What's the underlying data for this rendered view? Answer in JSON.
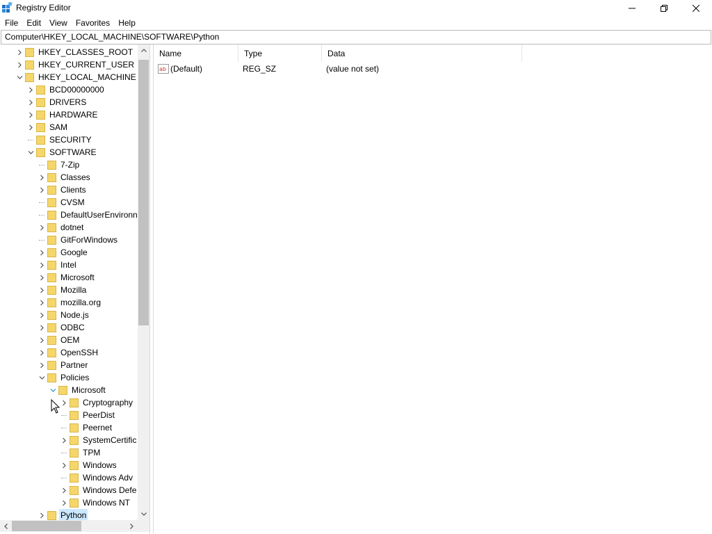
{
  "window": {
    "title": "Registry Editor",
    "minimize_glyph": "—",
    "maximize_glyph": "❐",
    "close_glyph": "✕"
  },
  "menu": [
    "File",
    "Edit",
    "View",
    "Favorites",
    "Help"
  ],
  "address": "Computer\\HKEY_LOCAL_MACHINE\\SOFTWARE\\Python",
  "tree": [
    {
      "label": "HKEY_CLASSES_ROOT",
      "level": 0,
      "expander": "collapsed"
    },
    {
      "label": "HKEY_CURRENT_USER",
      "level": 0,
      "expander": "collapsed"
    },
    {
      "label": "HKEY_LOCAL_MACHINE",
      "level": 0,
      "expander": "expanded"
    },
    {
      "label": "BCD00000000",
      "level": 1,
      "expander": "collapsed"
    },
    {
      "label": "DRIVERS",
      "level": 1,
      "expander": "collapsed"
    },
    {
      "label": "HARDWARE",
      "level": 1,
      "expander": "collapsed"
    },
    {
      "label": "SAM",
      "level": 1,
      "expander": "collapsed"
    },
    {
      "label": "SECURITY",
      "level": 1,
      "expander": "none"
    },
    {
      "label": "SOFTWARE",
      "level": 1,
      "expander": "expanded"
    },
    {
      "label": "7-Zip",
      "level": 2,
      "expander": "none"
    },
    {
      "label": "Classes",
      "level": 2,
      "expander": "collapsed"
    },
    {
      "label": "Clients",
      "level": 2,
      "expander": "collapsed"
    },
    {
      "label": "CVSM",
      "level": 2,
      "expander": "none"
    },
    {
      "label": "DefaultUserEnvironn",
      "level": 2,
      "expander": "none"
    },
    {
      "label": "dotnet",
      "level": 2,
      "expander": "collapsed"
    },
    {
      "label": "GitForWindows",
      "level": 2,
      "expander": "none"
    },
    {
      "label": "Google",
      "level": 2,
      "expander": "collapsed"
    },
    {
      "label": "Intel",
      "level": 2,
      "expander": "collapsed"
    },
    {
      "label": "Microsoft",
      "level": 2,
      "expander": "collapsed"
    },
    {
      "label": "Mozilla",
      "level": 2,
      "expander": "collapsed"
    },
    {
      "label": "mozilla.org",
      "level": 2,
      "expander": "collapsed"
    },
    {
      "label": "Node.js",
      "level": 2,
      "expander": "collapsed"
    },
    {
      "label": "ODBC",
      "level": 2,
      "expander": "collapsed"
    },
    {
      "label": "OEM",
      "level": 2,
      "expander": "collapsed"
    },
    {
      "label": "OpenSSH",
      "level": 2,
      "expander": "collapsed"
    },
    {
      "label": "Partner",
      "level": 2,
      "expander": "collapsed"
    },
    {
      "label": "Policies",
      "level": 2,
      "expander": "expanded"
    },
    {
      "label": "Microsoft",
      "level": 3,
      "expander": "expanded-hover"
    },
    {
      "label": "Cryptography",
      "level": 4,
      "expander": "collapsed"
    },
    {
      "label": "PeerDist",
      "level": 4,
      "expander": "none"
    },
    {
      "label": "Peernet",
      "level": 4,
      "expander": "none"
    },
    {
      "label": "SystemCertific",
      "level": 4,
      "expander": "collapsed"
    },
    {
      "label": "TPM",
      "level": 4,
      "expander": "none"
    },
    {
      "label": "Windows",
      "level": 4,
      "expander": "collapsed"
    },
    {
      "label": "Windows Adv",
      "level": 4,
      "expander": "none"
    },
    {
      "label": "Windows Defe",
      "level": 4,
      "expander": "collapsed"
    },
    {
      "label": "Windows NT",
      "level": 4,
      "expander": "collapsed"
    },
    {
      "label": "Python",
      "level": 2,
      "expander": "collapsed",
      "selected": true
    }
  ],
  "list": {
    "columns": [
      "Name",
      "Type",
      "Data"
    ],
    "rows": [
      {
        "name": "(Default)",
        "type": "REG_SZ",
        "data": "(value not set)",
        "icon": "string-value-icon"
      }
    ]
  },
  "colors": {
    "selection": "#cce8ff",
    "folder": "#f5d66b",
    "folder_edge": "#d9b545",
    "accent": "#1e90d6"
  }
}
